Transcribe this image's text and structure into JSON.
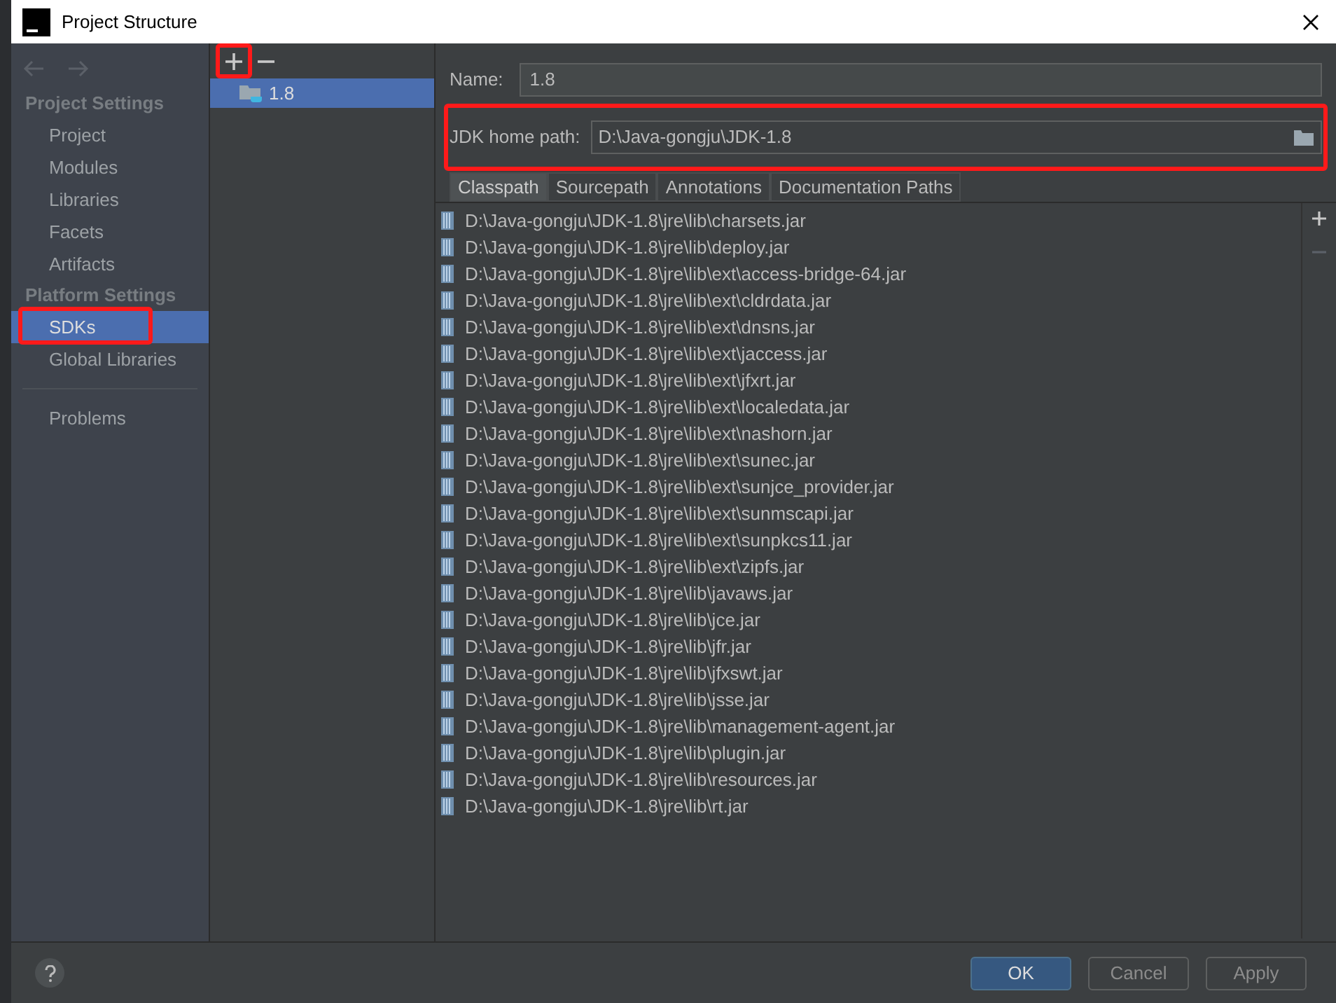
{
  "window": {
    "title": "Project Structure"
  },
  "nav": {
    "sections": [
      {
        "title": "Project Settings",
        "items": [
          {
            "label": "Project",
            "selected": false,
            "annotated": false
          },
          {
            "label": "Modules",
            "selected": false,
            "annotated": false
          },
          {
            "label": "Libraries",
            "selected": false,
            "annotated": false
          },
          {
            "label": "Facets",
            "selected": false,
            "annotated": false
          },
          {
            "label": "Artifacts",
            "selected": false,
            "annotated": false
          }
        ]
      },
      {
        "title": "Platform Settings",
        "items": [
          {
            "label": "SDKs",
            "selected": true,
            "annotated": true
          },
          {
            "label": "Global Libraries",
            "selected": false,
            "annotated": false
          }
        ]
      }
    ],
    "footer_items": [
      {
        "label": "Problems",
        "selected": false
      }
    ]
  },
  "sdk_list": {
    "add_annotated": true,
    "items": [
      {
        "label": "1.8",
        "selected": true
      }
    ]
  },
  "form": {
    "name": {
      "label": "Name:",
      "value": "1.8"
    },
    "jdk_home": {
      "label": "JDK home path:",
      "value": "D:\\Java-gongju\\JDK-1.8",
      "annotated": true
    }
  },
  "tabs": [
    {
      "label": "Classpath",
      "selected": true
    },
    {
      "label": "Sourcepath",
      "selected": false
    },
    {
      "label": "Annotations",
      "selected": false
    },
    {
      "label": "Documentation Paths",
      "selected": false
    }
  ],
  "classpath": [
    "D:\\Java-gongju\\JDK-1.8\\jre\\lib\\charsets.jar",
    "D:\\Java-gongju\\JDK-1.8\\jre\\lib\\deploy.jar",
    "D:\\Java-gongju\\JDK-1.8\\jre\\lib\\ext\\access-bridge-64.jar",
    "D:\\Java-gongju\\JDK-1.8\\jre\\lib\\ext\\cldrdata.jar",
    "D:\\Java-gongju\\JDK-1.8\\jre\\lib\\ext\\dnsns.jar",
    "D:\\Java-gongju\\JDK-1.8\\jre\\lib\\ext\\jaccess.jar",
    "D:\\Java-gongju\\JDK-1.8\\jre\\lib\\ext\\jfxrt.jar",
    "D:\\Java-gongju\\JDK-1.8\\jre\\lib\\ext\\localedata.jar",
    "D:\\Java-gongju\\JDK-1.8\\jre\\lib\\ext\\nashorn.jar",
    "D:\\Java-gongju\\JDK-1.8\\jre\\lib\\ext\\sunec.jar",
    "D:\\Java-gongju\\JDK-1.8\\jre\\lib\\ext\\sunjce_provider.jar",
    "D:\\Java-gongju\\JDK-1.8\\jre\\lib\\ext\\sunmscapi.jar",
    "D:\\Java-gongju\\JDK-1.8\\jre\\lib\\ext\\sunpkcs11.jar",
    "D:\\Java-gongju\\JDK-1.8\\jre\\lib\\ext\\zipfs.jar",
    "D:\\Java-gongju\\JDK-1.8\\jre\\lib\\javaws.jar",
    "D:\\Java-gongju\\JDK-1.8\\jre\\lib\\jce.jar",
    "D:\\Java-gongju\\JDK-1.8\\jre\\lib\\jfr.jar",
    "D:\\Java-gongju\\JDK-1.8\\jre\\lib\\jfxswt.jar",
    "D:\\Java-gongju\\JDK-1.8\\jre\\lib\\jsse.jar",
    "D:\\Java-gongju\\JDK-1.8\\jre\\lib\\management-agent.jar",
    "D:\\Java-gongju\\JDK-1.8\\jre\\lib\\plugin.jar",
    "D:\\Java-gongju\\JDK-1.8\\jre\\lib\\resources.jar",
    "D:\\Java-gongju\\JDK-1.8\\jre\\lib\\rt.jar"
  ],
  "buttons": [
    {
      "label": "OK",
      "kind": "primary"
    },
    {
      "label": "Cancel",
      "kind": "normal"
    },
    {
      "label": "Apply",
      "kind": "normal"
    }
  ]
}
